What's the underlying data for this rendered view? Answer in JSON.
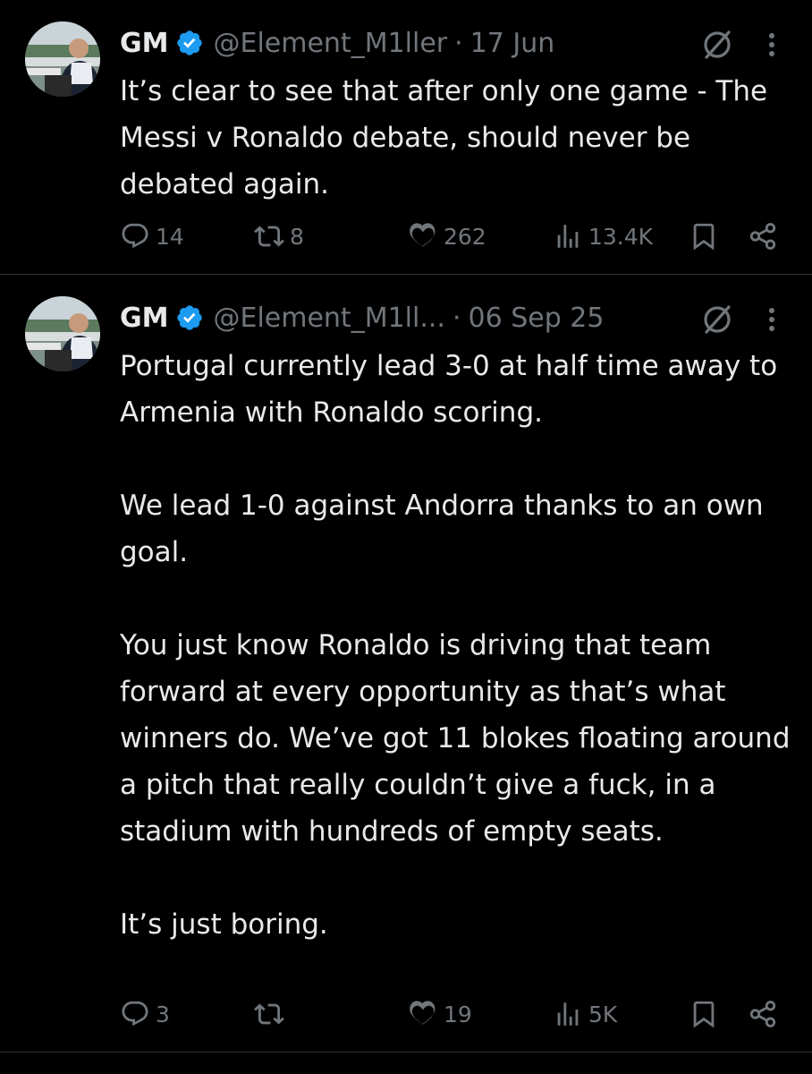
{
  "tweets": [
    {
      "name": "GM",
      "handle": "@Element_M1ller",
      "separator": "·",
      "date": "17 Jun",
      "paragraphs": [
        "It’s clear to see that after only one game - The Messi v Ronaldo debate, should never be debated again."
      ],
      "stats": {
        "replies": "14",
        "reposts": "8",
        "likes": "262",
        "views": "13.4K"
      }
    },
    {
      "name": "GM",
      "handle": "@Element_M1ll...",
      "separator": "·",
      "date": "06 Sep 25",
      "paragraphs": [
        "Portugal currently lead 3-0 at half time away to Armenia with Ronaldo scoring.",
        "We lead 1-0 against Andorra thanks to an own goal.",
        "You just know Ronaldo is driving that team forward at every opportunity as that’s what winners do. We’ve got 11 blokes floating around a pitch that really couldn’t give a fuck, in a stadium with hundreds of empty seats.",
        "It’s just boring."
      ],
      "stats": {
        "replies": "3",
        "reposts": "",
        "likes": "19",
        "views": "5K"
      }
    }
  ],
  "colors": {
    "background": "#000000",
    "text": "#e7e9ea",
    "muted": "#71767b",
    "verified": "#1d9bf0",
    "divider": "#2f3336"
  },
  "icons": [
    "verified-badge-icon",
    "grok-icon",
    "more-icon",
    "reply-icon",
    "repost-icon",
    "like-icon",
    "views-icon",
    "bookmark-icon",
    "share-icon"
  ]
}
